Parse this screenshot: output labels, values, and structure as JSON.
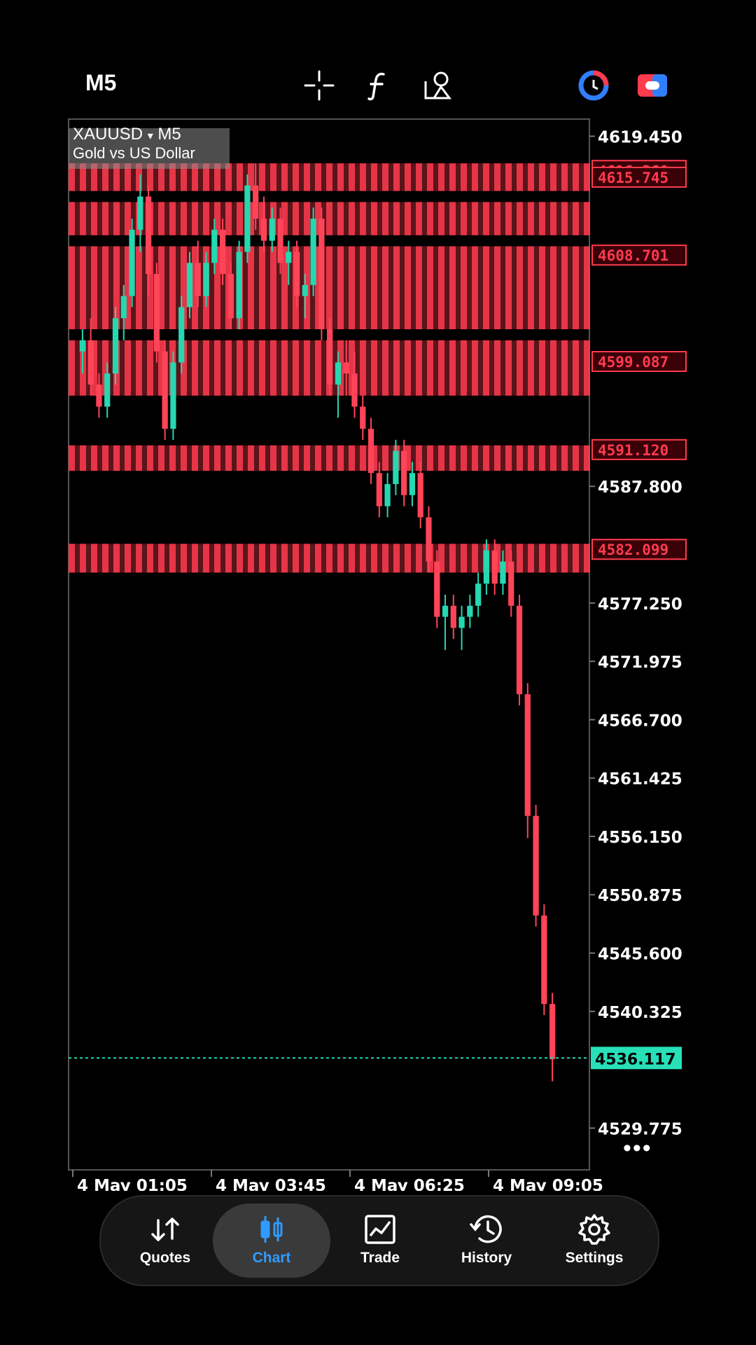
{
  "topbar": {
    "timeframe": "M5",
    "crosshair_icon": "crosshair-icon",
    "indicator_icon": "function-icon",
    "objects_icon": "objects-icon",
    "oneclick_icon": "clock-ring-icon",
    "trade_panel_icon": "toggle-icon"
  },
  "symbol": {
    "name": "XAUUSD",
    "dropdown_glyph": "▾",
    "timeframe": "M5",
    "description": "Gold vs US Dollar"
  },
  "chart_data": {
    "type": "candlestick",
    "ylim": [
      4526,
      4621
    ],
    "y_ticks": [
      "4619.450",
      "4587.800",
      "4577.250",
      "4571.975",
      "4566.700",
      "4561.425",
      "4556.150",
      "4550.875",
      "4545.600",
      "4540.325",
      "4529.775"
    ],
    "x_ticks": [
      "4 May 01:05",
      "4 May 03:45",
      "4 May 06:25",
      "4 May 09:05"
    ],
    "current_price": "4536.117",
    "price_tags": [
      "4616.360",
      "4615.745",
      "4608.701",
      "4599.087",
      "4591.120",
      "4582.099"
    ],
    "sell_zones": [
      {
        "top": 4617.0,
        "bottom": 4614.5
      },
      {
        "top": 4613.5,
        "bottom": 4610.5
      },
      {
        "top": 4609.5,
        "bottom": 4602.0
      },
      {
        "top": 4601.0,
        "bottom": 4596.0
      },
      {
        "top": 4591.5,
        "bottom": 4589.2
      },
      {
        "top": 4582.6,
        "bottom": 4580.0
      }
    ],
    "candles": [
      [
        4600,
        4602,
        4598,
        4601
      ],
      [
        4601,
        4603,
        4596,
        4597
      ],
      [
        4597,
        4598,
        4594,
        4595
      ],
      [
        4595,
        4599,
        4594,
        4598
      ],
      [
        4598,
        4604,
        4597,
        4603
      ],
      [
        4603,
        4606,
        4601,
        4605
      ],
      [
        4605,
        4612,
        4604,
        4611
      ],
      [
        4611,
        4616,
        4609,
        4614
      ],
      [
        4614,
        4615,
        4605,
        4607
      ],
      [
        4607,
        4608,
        4599,
        4600
      ],
      [
        4600,
        4601,
        4592,
        4593
      ],
      [
        4593,
        4600,
        4592,
        4599
      ],
      [
        4599,
        4605,
        4598,
        4604
      ],
      [
        4604,
        4609,
        4603,
        4608
      ],
      [
        4608,
        4610,
        4604,
        4605
      ],
      [
        4605,
        4609,
        4604,
        4608
      ],
      [
        4608,
        4612,
        4607,
        4611
      ],
      [
        4611,
        4612,
        4606,
        4607
      ],
      [
        4607,
        4608,
        4602,
        4603
      ],
      [
        4603,
        4610,
        4602,
        4609
      ],
      [
        4609,
        4616,
        4608,
        4615
      ],
      [
        4615,
        4617,
        4611,
        4612
      ],
      [
        4612,
        4614,
        4609,
        4610
      ],
      [
        4610,
        4613,
        4609,
        4612
      ],
      [
        4612,
        4613,
        4607,
        4608
      ],
      [
        4608,
        4610,
        4606,
        4609
      ],
      [
        4609,
        4610,
        4604,
        4605
      ],
      [
        4605,
        4607,
        4603,
        4606
      ],
      [
        4606,
        4613,
        4605,
        4612
      ],
      [
        4612,
        4613,
        4601,
        4602
      ],
      [
        4602,
        4603,
        4596,
        4597
      ],
      [
        4597,
        4600,
        4594,
        4599
      ],
      [
        4599,
        4601,
        4596,
        4598
      ],
      [
        4598,
        4600,
        4594,
        4595
      ],
      [
        4595,
        4596,
        4592,
        4593
      ],
      [
        4593,
        4594,
        4588,
        4589
      ],
      [
        4589,
        4590,
        4585,
        4586
      ],
      [
        4586,
        4589,
        4585,
        4588
      ],
      [
        4588,
        4592,
        4587,
        4591
      ],
      [
        4591,
        4592,
        4586,
        4587
      ],
      [
        4587,
        4590,
        4586,
        4589
      ],
      [
        4589,
        4590,
        4584,
        4585
      ],
      [
        4585,
        4586,
        4580,
        4581
      ],
      [
        4581,
        4582,
        4575,
        4576
      ],
      [
        4576,
        4578,
        4573,
        4577
      ],
      [
        4577,
        4578,
        4574,
        4575
      ],
      [
        4575,
        4577,
        4573,
        4576
      ],
      [
        4576,
        4578,
        4575,
        4577
      ],
      [
        4577,
        4580,
        4576,
        4579
      ],
      [
        4579,
        4583,
        4578,
        4582
      ],
      [
        4582,
        4583,
        4578,
        4579
      ],
      [
        4579,
        4582,
        4578,
        4581
      ],
      [
        4581,
        4582,
        4576,
        4577
      ],
      [
        4577,
        4578,
        4568,
        4569
      ],
      [
        4569,
        4570,
        4556,
        4558
      ],
      [
        4558,
        4559,
        4548,
        4549
      ],
      [
        4549,
        4550,
        4540,
        4541
      ],
      [
        4541,
        4542,
        4534,
        4536
      ]
    ]
  },
  "nav": {
    "items": [
      {
        "label": "Quotes",
        "icon": "quotes-icon"
      },
      {
        "label": "Chart",
        "icon": "chart-icon"
      },
      {
        "label": "Trade",
        "icon": "trade-icon"
      },
      {
        "label": "History",
        "icon": "history-icon"
      },
      {
        "label": "Settings",
        "icon": "settings-icon"
      }
    ],
    "active": "Chart"
  },
  "colors": {
    "bull": "#26d7b0",
    "bear": "#ff4458",
    "zone": "#ff3b4e",
    "current_price_bg": "#28e0b8",
    "active_nav": "#2f9bff"
  }
}
